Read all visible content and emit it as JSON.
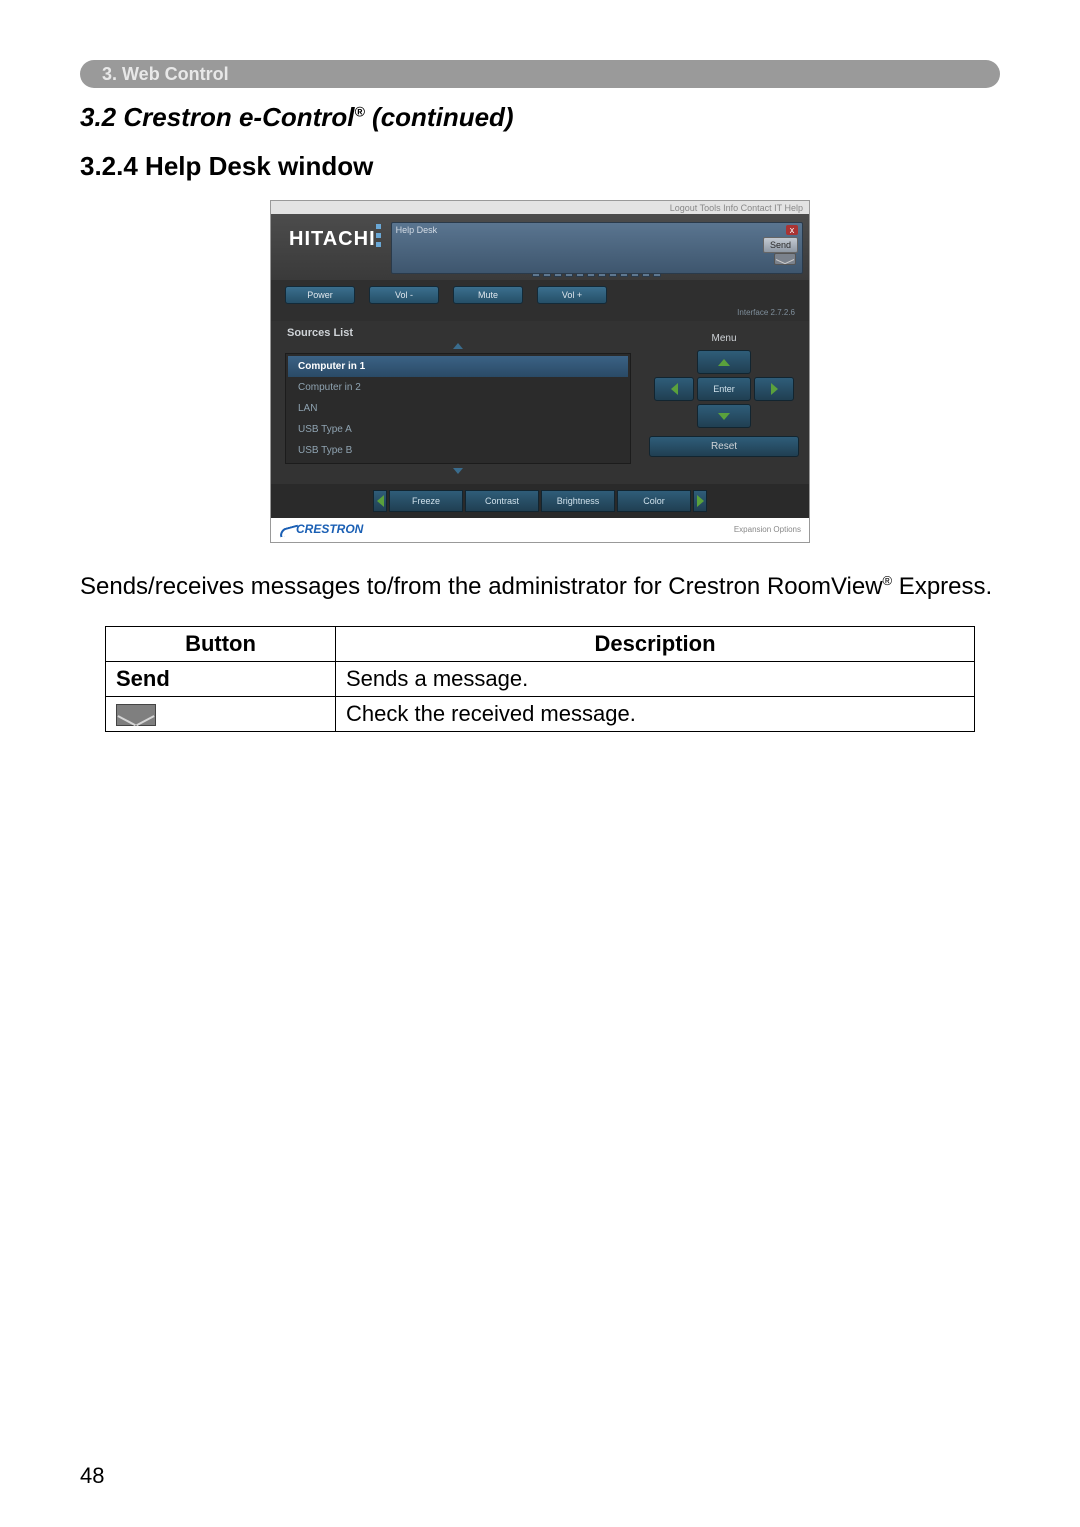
{
  "tab_label": "3. Web Control",
  "section_title_prefix": "3.2 Crestron e-Control",
  "section_title_suffix": " (continued)",
  "registered": "®",
  "subsection_title": "3.2.4 Help Desk window",
  "body_text_a": "Sends/receives messages to/from the administrator for Crestron RoomView",
  "body_text_b": " Express.",
  "table": {
    "head_button": "Button",
    "head_description": "Description",
    "rows": [
      {
        "button": "Send",
        "button_is_icon": false,
        "description": "Sends a message."
      },
      {
        "button": "mail-icon",
        "button_is_icon": true,
        "description": "Check the received message."
      }
    ]
  },
  "page_number": "48",
  "screenshot": {
    "top_links": "Logout       Tools       Info       Contact IT Help",
    "logo": "HITACHI",
    "help_title": "Help Desk",
    "send_label": "Send",
    "close_label": "x",
    "controls": [
      "Power",
      "Vol -",
      "Mute",
      "Vol +"
    ],
    "version": "Interface 2.7.2.6",
    "sources_title": "Sources List",
    "sources": [
      "Computer in 1",
      "Computer in 2",
      "LAN",
      "USB Type A",
      "USB Type B"
    ],
    "menu_label": "Menu",
    "enter_label": "Enter",
    "reset_label": "Reset",
    "bottom": [
      "Freeze",
      "Contrast",
      "Brightness",
      "Color"
    ],
    "crestron": "CRESTRON",
    "expansion": "Expansion Options"
  }
}
